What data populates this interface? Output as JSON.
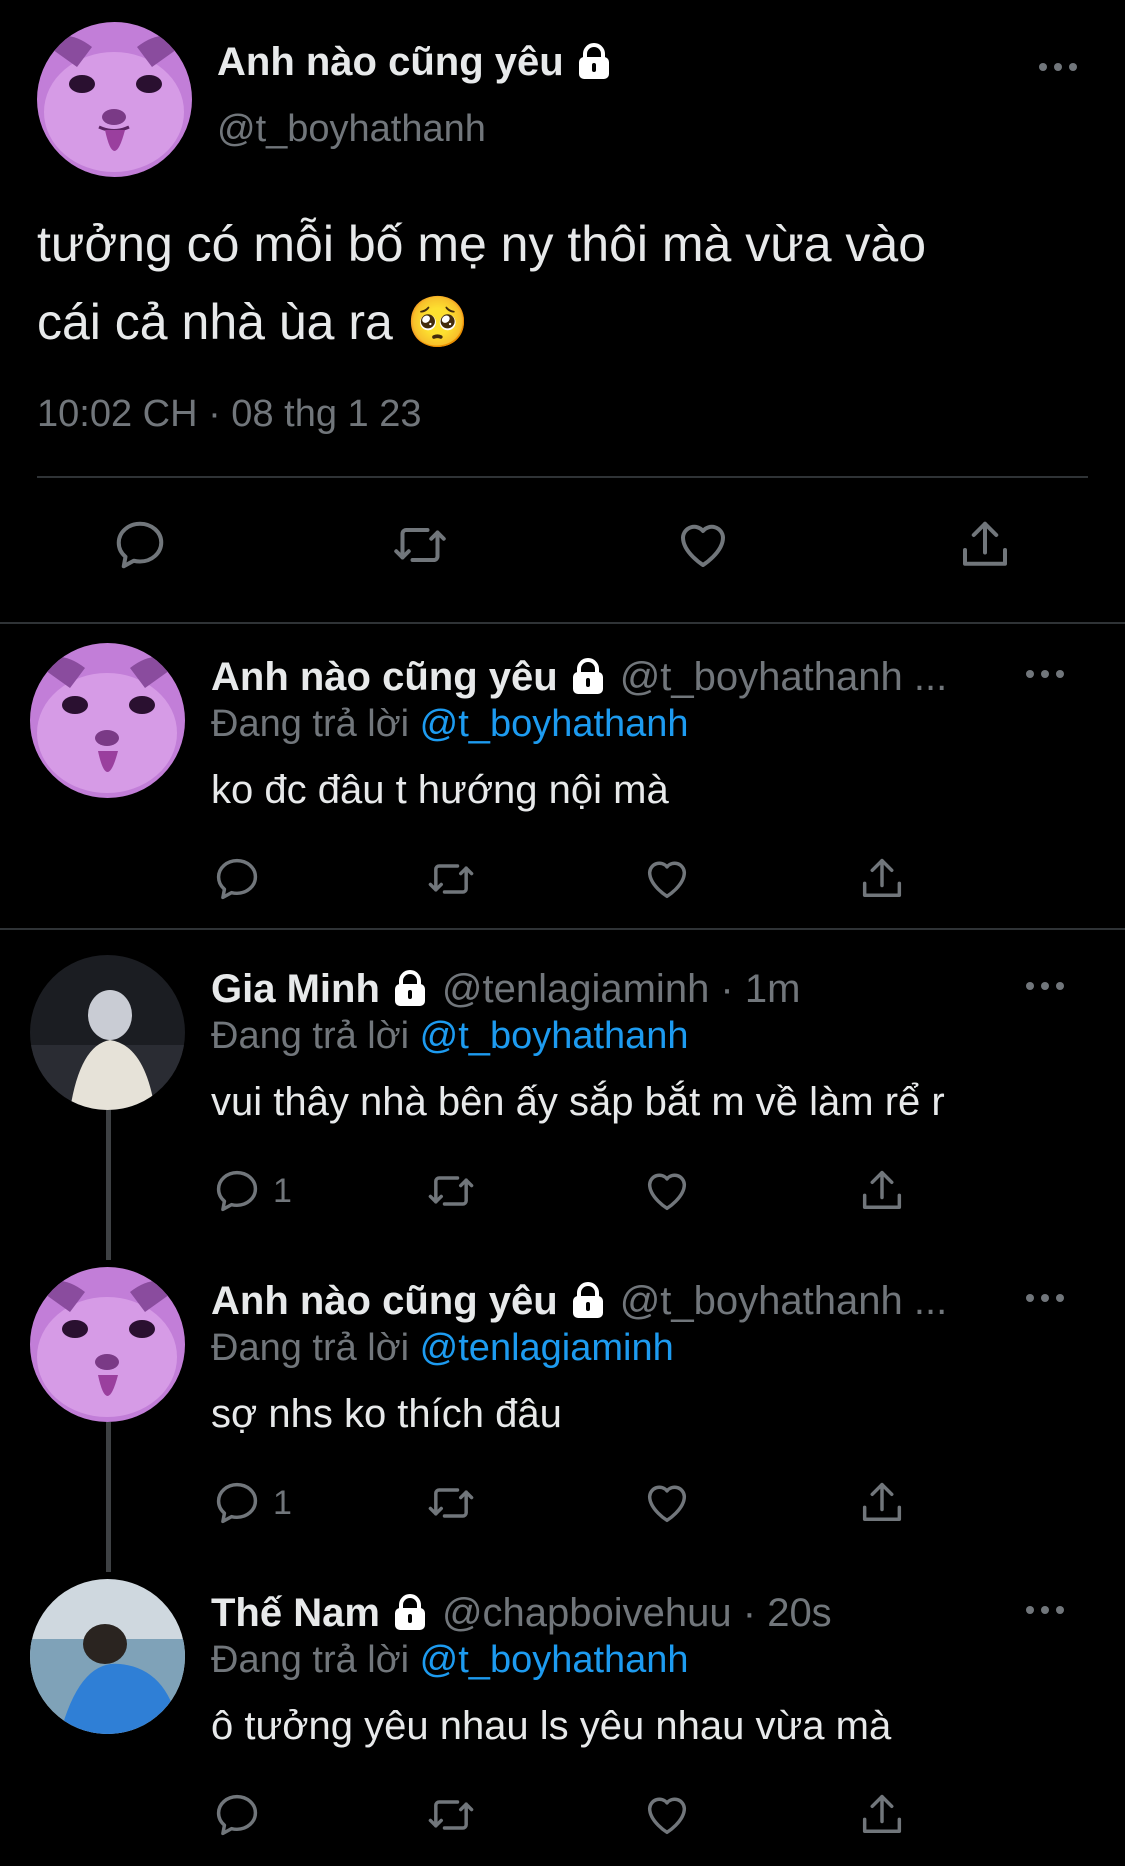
{
  "main_tweet": {
    "name": "Anh nào cũng yêu",
    "handle": "@t_boyhathanh",
    "text_line1": "tưởng có mỗi bố mẹ ny thôi mà vừa vào",
    "text_line2": "cái cả nhà ùa ra",
    "emoji": "🥺",
    "timestamp": "10:02 CH · 08 thg 1 23"
  },
  "replying_prefix": "Đang trả lời",
  "replies": [
    {
      "name": "Anh nào cũng yêu",
      "handle": "@t_boyhathanh ...",
      "replying_to": "@t_boyhathanh",
      "text": "ko đc đâu t hướng nội mà",
      "reply_count": ""
    },
    {
      "name": "Gia Minh",
      "handle": "@tenlagiaminh · 1m",
      "replying_to": "@t_boyhathanh",
      "text": "vui thây nhà bên ấy sắp bắt m về làm rể r",
      "reply_count": "1"
    },
    {
      "name": "Anh nào cũng yêu",
      "handle": "@t_boyhathanh ...",
      "replying_to": "@tenlagiaminh",
      "text": "sợ nhs ko thích đâu",
      "reply_count": "1"
    },
    {
      "name": "Thế Nam",
      "handle": "@chapboivehuu · 20s",
      "replying_to": "@t_boyhathanh",
      "text": "ô tưởng yêu nhau ls yêu nhau vừa mà",
      "reply_count": ""
    }
  ],
  "icons": {
    "reply": "reply-icon",
    "retweet": "retweet-icon",
    "like": "heart-icon",
    "share": "share-icon",
    "more": "more-icon",
    "lock": "lock-icon"
  },
  "colors": {
    "background": "#000000",
    "text": "#e7e9ea",
    "secondary": "#71767b",
    "link": "#1d9bf0",
    "divider": "#2f3336"
  }
}
